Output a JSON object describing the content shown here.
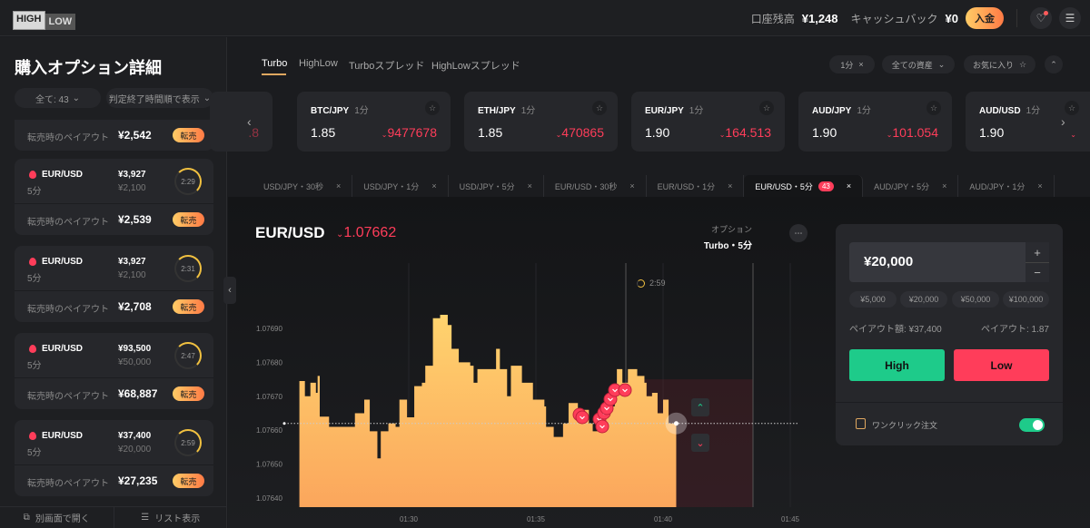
{
  "header": {
    "logo_high": "HIGH",
    "logo_low": "LOW",
    "balance_label": "口座残高",
    "balance": "¥1,248",
    "cashback_label": "キャッシュバック",
    "cashback": "¥0",
    "deposit": "入金"
  },
  "sidebar": {
    "title": "購入オプション詳細",
    "filter": "全て: 43",
    "sort": "判定終了時間順で表示",
    "partial": {
      "payout_label": "転売時のペイアウト",
      "payout": "¥2,542",
      "sell": "転売"
    },
    "cards": [
      {
        "pair": "EUR/USD",
        "duration": "5分",
        "payout_amount": "¥3,927",
        "investment": "¥2,100",
        "timer": "2:29",
        "payout_label": "転売時のペイアウト",
        "resale": "¥2,539",
        "sell": "転売"
      },
      {
        "pair": "EUR/USD",
        "duration": "5分",
        "payout_amount": "¥3,927",
        "investment": "¥2,100",
        "timer": "2:31",
        "payout_label": "転売時のペイアウト",
        "resale": "¥2,708",
        "sell": "転売"
      },
      {
        "pair": "EUR/USD",
        "duration": "5分",
        "payout_amount": "¥93,500",
        "investment": "¥50,000",
        "timer": "2:47",
        "payout_label": "転売時のペイアウト",
        "resale": "¥68,887",
        "sell": "転売"
      },
      {
        "pair": "EUR/USD",
        "duration": "5分",
        "payout_amount": "¥37,400",
        "investment": "¥20,000",
        "timer": "2:59",
        "payout_label": "転売時のペイアウト",
        "resale": "¥27,235",
        "sell": "転売"
      }
    ],
    "open_window": "別画面で開く",
    "list_view": "リスト表示"
  },
  "main": {
    "tabs": [
      "Turbo",
      "HighLow",
      "Turboスプレッド",
      "HighLowスプレッド"
    ],
    "active_tab": "Turbo",
    "filters": {
      "duration": "1分",
      "assets": "全ての資産",
      "favorites": "お気に入り"
    },
    "partial_price": ".8",
    "assets": [
      {
        "pair": "BTC/JPY",
        "duration": "1分",
        "payout": "1.85",
        "price": "9477678"
      },
      {
        "pair": "ETH/JPY",
        "duration": "1分",
        "payout": "1.85",
        "price": "470865"
      },
      {
        "pair": "EUR/JPY",
        "duration": "1分",
        "payout": "1.90",
        "price": "164.513"
      },
      {
        "pair": "AUD/JPY",
        "duration": "1分",
        "payout": "1.90",
        "price": "101.054"
      },
      {
        "pair": "AUD/USD",
        "duration": "1分",
        "payout": "1.90",
        "price": ""
      }
    ],
    "chart_tabs": [
      {
        "label": "USD/JPY・30秒"
      },
      {
        "label": "USD/JPY・1分"
      },
      {
        "label": "USD/JPY・5分"
      },
      {
        "label": "EUR/USD・30秒"
      },
      {
        "label": "EUR/USD・1分"
      },
      {
        "label": "EUR/USD・5分",
        "badge": "43",
        "active": true
      },
      {
        "label": "AUD/JPY・5分"
      },
      {
        "label": "AUD/JPY・1分"
      }
    ]
  },
  "chart": {
    "pair": "EUR/USD",
    "price": "1.07662",
    "option_label": "オプション",
    "option_value": "Turbo・5分",
    "countdown": "2:59"
  },
  "trade_panel": {
    "amount": "¥20,000",
    "quick": [
      "¥5,000",
      "¥20,000",
      "¥50,000",
      "¥100,000"
    ],
    "payout_amount_label": "ペイアウト額: ¥37,400",
    "payout_rate_label": "ペイアウト: 1.87",
    "high": "High",
    "low": "Low",
    "one_click": "ワンクリック注文",
    "one_click_on": true
  },
  "colors": {
    "accent": "#ffb347",
    "up": "#1ecb8a",
    "down": "#ff3d5a"
  },
  "chart_data": {
    "type": "area",
    "ylim": [
      1.07637,
      1.07697
    ],
    "yticks": [
      "1.07640",
      "1.07650",
      "1.07660",
      "1.07670",
      "1.07680",
      "1.07690"
    ],
    "xticks": [
      "01:30",
      "01:35",
      "01:40",
      "01:45"
    ],
    "current_price": 1.07662,
    "points": [
      [
        "01:25:42",
        1.076745
      ],
      [
        "01:25:55",
        1.0767
      ],
      [
        "01:26:08",
        1.07674
      ],
      [
        "01:26:21",
        1.07671
      ],
      [
        "01:26:25",
        1.07676
      ],
      [
        "01:26:30",
        1.07664
      ],
      [
        "01:26:47",
        1.07664
      ],
      [
        "01:26:52",
        1.07661
      ],
      [
        "01:27:49",
        1.07661
      ],
      [
        "01:27:53",
        1.07665
      ],
      [
        "01:28:15",
        1.07669
      ],
      [
        "01:28:28",
        1.076597
      ],
      [
        "01:28:46",
        1.076517
      ],
      [
        "01:28:54",
        1.076597
      ],
      [
        "01:29:12",
        1.07662
      ],
      [
        "01:29:29",
        1.07661
      ],
      [
        "01:29:38",
        1.07669
      ],
      [
        "01:29:56",
        1.076638
      ],
      [
        "01:30:13",
        1.07673
      ],
      [
        "01:30:31",
        1.07674
      ],
      [
        "01:30:39",
        1.07679
      ],
      [
        "01:30:57",
        1.07693
      ],
      [
        "01:31:14",
        1.07694
      ],
      [
        "01:31:32",
        1.07691
      ],
      [
        "01:31:41",
        1.07684
      ],
      [
        "01:31:58",
        1.0768
      ],
      [
        "01:32:25",
        1.07679
      ],
      [
        "01:32:33",
        1.07674
      ],
      [
        "01:32:42",
        1.07678
      ],
      [
        "01:33:08",
        1.07678
      ],
      [
        "01:33:26",
        1.07684
      ],
      [
        "01:33:35",
        1.07678
      ],
      [
        "01:33:52",
        1.0767
      ],
      [
        "01:34:01",
        1.07679
      ],
      [
        "01:34:27",
        1.07674
      ],
      [
        "01:34:53",
        1.07669
      ],
      [
        "01:35:20",
        1.07667
      ],
      [
        "01:35:24",
        1.07661
      ],
      [
        "01:35:42",
        1.07658
      ],
      [
        "01:36:04",
        1.07662
      ],
      [
        "01:36:17",
        1.07668
      ],
      [
        "01:36:39",
        1.07666
      ],
      [
        "01:37:05",
        1.07662
      ],
      [
        "01:37:14",
        1.076597
      ],
      [
        "01:37:31",
        1.07664
      ],
      [
        "01:37:49",
        1.07667
      ],
      [
        "01:38:06",
        1.07671
      ],
      [
        "01:38:11",
        1.07678
      ],
      [
        "01:38:24",
        1.07674
      ],
      [
        "01:38:37",
        1.07678
      ],
      [
        "01:38:59",
        1.07676
      ],
      [
        "01:39:16",
        1.07674
      ],
      [
        "01:39:21",
        1.0767
      ],
      [
        "01:39:34",
        1.07671
      ],
      [
        "01:39:47",
        1.07665
      ],
      [
        "01:40:00",
        1.07669
      ],
      [
        "01:40:13",
        1.07662
      ],
      [
        "01:40:31",
        1.076615
      ]
    ]
  }
}
